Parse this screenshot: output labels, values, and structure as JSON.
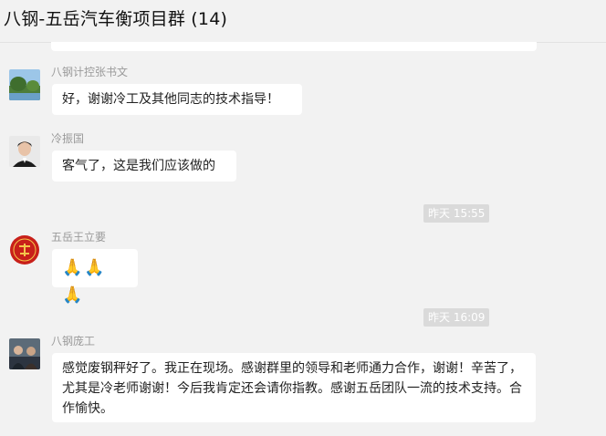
{
  "header": {
    "title": "八钢-五岳汽车衡项目群 (14)"
  },
  "messages": [
    {
      "sender": "八钢计控张书文",
      "text": "好，谢谢冷工及其他同志的技术指导！"
    },
    {
      "sender": "冷振国",
      "text": "客气了，这是我们应该做的"
    },
    {
      "time": "昨天 15:55"
    },
    {
      "sender": "五岳王立要",
      "emojis": [
        "🙏",
        "🙏",
        "🙏"
      ]
    },
    {
      "time": "昨天 16:09"
    },
    {
      "sender": "八钢庞工",
      "text": "感觉废钢秤好了。我正在现场。感谢群里的领导和老师通力合作，谢谢！辛苦了，尤其是冷老师谢谢！今后我肯定还会请你指教。感谢五岳团队一流的技术支持。合作愉快。"
    }
  ],
  "colors": {
    "background": "#f2f2f2",
    "bubble": "#ffffff",
    "time_badge": "#dadada"
  }
}
